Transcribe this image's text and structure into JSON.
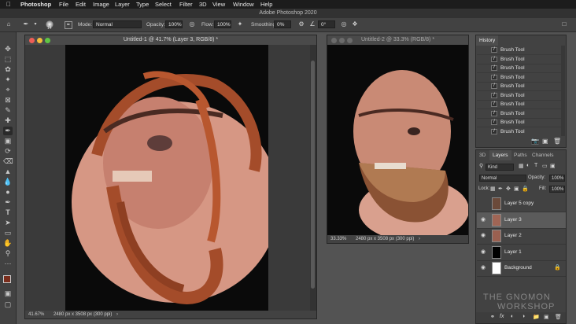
{
  "colors": {
    "accent": "#2f7ad9",
    "canvas_bg": "#0a0a0a",
    "skin": "#d79a86",
    "hair": "#a44c2a"
  },
  "menubar": {
    "apple_icon": "apple-icon",
    "items": [
      "Photoshop",
      "File",
      "Edit",
      "Image",
      "Layer",
      "Type",
      "Select",
      "Filter",
      "3D",
      "View",
      "Window",
      "Help"
    ]
  },
  "app_title": "Adobe Photoshop 2020",
  "options": {
    "brush_size": "14",
    "mode_label": "Mode:",
    "mode_value": "Normal",
    "opacity_label": "Opacity:",
    "opacity_value": "100%",
    "flow_label": "Flow:",
    "flow_value": "100%",
    "smoothing_label": "Smoothing:",
    "smoothing_value": "0%",
    "angle_value": "0°"
  },
  "doc1": {
    "title": "Untitled-1 @ 41.7% (Layer 3, RGB/8) *",
    "zoom": "41.67%",
    "info": "2480 px x 3508 px (300 ppi)"
  },
  "doc2": {
    "title": "Untitled-2 @ 33.3% (RGB/8) *",
    "zoom": "33.33%",
    "info": "2480 px x 3508 px (300 ppi)"
  },
  "history": {
    "title": "History",
    "items": [
      "Brush Tool",
      "Brush Tool",
      "Brush Tool",
      "Brush Tool",
      "Brush Tool",
      "Brush Tool",
      "Brush Tool",
      "Brush Tool",
      "Brush Tool",
      "Brush Tool"
    ]
  },
  "layers_panel": {
    "tabs": [
      "3D",
      "Layers",
      "Paths",
      "Channels"
    ],
    "filter_value": "Kind",
    "blend_mode": "Normal",
    "opacity_label": "Opacity:",
    "opacity_value": "100%",
    "lock_label": "Lock:",
    "fill_label": "Fill:",
    "fill_value": "100%",
    "layers": [
      {
        "name": "Layer 5 copy",
        "visible": false,
        "selected": false
      },
      {
        "name": "Layer 3",
        "visible": true,
        "selected": true
      },
      {
        "name": "Layer 2",
        "visible": true,
        "selected": false
      },
      {
        "name": "Layer 1",
        "visible": true,
        "selected": false
      },
      {
        "name": "Background",
        "visible": true,
        "selected": false
      }
    ]
  },
  "watermark": {
    "line1": "THE GNOMON",
    "line2": "WORKSHOP"
  }
}
